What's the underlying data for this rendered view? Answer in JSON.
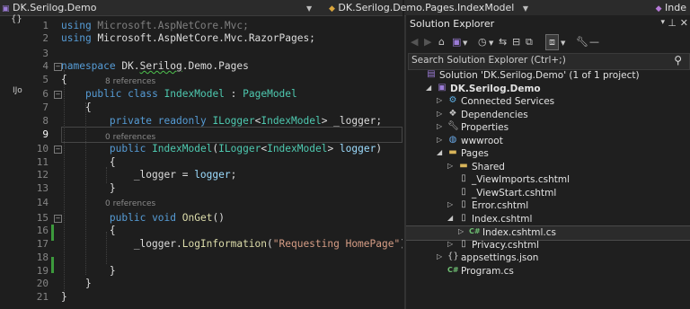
{
  "navbar": {
    "project": "DK.Serilog.Demo",
    "class_path": "DK.Serilog.Demo.Pages.IndexModel",
    "member": "Inde"
  },
  "editor": {
    "refs_line6": "8 references",
    "refs_line10": "0 references",
    "refs_line15": "0 references",
    "lines": [
      {
        "n": "1",
        "parts": [
          [
            "kw",
            "using"
          ],
          [
            "dim",
            " Microsoft.AspNetCore.Mvc;"
          ]
        ]
      },
      {
        "n": "2",
        "parts": [
          [
            "kw",
            "using"
          ],
          [
            "",
            ""
          ],
          [
            "",
            "Microsoft.AspNetCore.Mvc.RazorPages;"
          ]
        ]
      },
      {
        "n": "3",
        "parts": []
      },
      {
        "n": "4",
        "parts": [
          [
            "kw",
            "namespace"
          ],
          [
            "",
            " DK."
          ],
          [
            "squig",
            "Serilog"
          ],
          [
            "",
            ".Demo.Pages"
          ]
        ]
      },
      {
        "n": "5",
        "parts": [
          [
            "",
            "{"
          ]
        ]
      },
      {
        "n": "6",
        "parts": [
          [
            "",
            "    "
          ],
          [
            "kw",
            "public"
          ],
          [
            "",
            " "
          ],
          [
            "kw",
            "class"
          ],
          [
            "",
            " "
          ],
          [
            "ty",
            "IndexModel"
          ],
          [
            "",
            " : "
          ],
          [
            "ty",
            "PageModel"
          ]
        ]
      },
      {
        "n": "7",
        "parts": [
          [
            "",
            "    {"
          ]
        ]
      },
      {
        "n": "8",
        "parts": [
          [
            "",
            "        "
          ],
          [
            "kw",
            "private"
          ],
          [
            "",
            " "
          ],
          [
            "kw",
            "readonly"
          ],
          [
            "",
            " "
          ],
          [
            "ty",
            "ILogger"
          ],
          [
            "",
            "<"
          ],
          [
            "ty",
            "IndexModel"
          ],
          [
            "",
            "> _logger;"
          ]
        ]
      },
      {
        "n": "9",
        "parts": []
      },
      {
        "n": "10",
        "parts": [
          [
            "",
            "        "
          ],
          [
            "kw",
            "public"
          ],
          [
            "",
            " "
          ],
          [
            "ty",
            "IndexModel"
          ],
          [
            "",
            "("
          ],
          [
            "ty",
            "ILogger"
          ],
          [
            "",
            "<"
          ],
          [
            "ty",
            "IndexModel"
          ],
          [
            "",
            "> "
          ],
          [
            "pa",
            "logger"
          ],
          [
            "",
            ")"
          ]
        ]
      },
      {
        "n": "11",
        "parts": [
          [
            "",
            "        {"
          ]
        ]
      },
      {
        "n": "12",
        "parts": [
          [
            "",
            "            _logger = "
          ],
          [
            "pa",
            "logger"
          ],
          [
            "",
            ";"
          ]
        ]
      },
      {
        "n": "13",
        "parts": [
          [
            "",
            "        }"
          ]
        ]
      },
      {
        "n": "14",
        "parts": []
      },
      {
        "n": "15",
        "parts": [
          [
            "",
            "        "
          ],
          [
            "kw",
            "public"
          ],
          [
            "",
            " "
          ],
          [
            "kw",
            "void"
          ],
          [
            "",
            " "
          ],
          [
            "fn",
            "OnGet"
          ],
          [
            "",
            "()"
          ]
        ]
      },
      {
        "n": "16",
        "parts": [
          [
            "",
            "        {"
          ]
        ]
      },
      {
        "n": "17",
        "parts": [
          [
            "",
            "            _logger."
          ],
          [
            "fn",
            "LogInformation"
          ],
          [
            "",
            "("
          ],
          [
            "st",
            "\"Requesting HomePage\""
          ],
          [
            "",
            ");"
          ]
        ]
      },
      {
        "n": "18",
        "parts": []
      },
      {
        "n": "19",
        "parts": [
          [
            "",
            "        }"
          ]
        ]
      },
      {
        "n": "20",
        "parts": [
          [
            "",
            "    }"
          ]
        ]
      },
      {
        "n": "21",
        "parts": [
          [
            "",
            "}"
          ]
        ]
      }
    ]
  },
  "solution_explorer": {
    "title": "Solution Explorer",
    "search_placeholder": "Search Solution Explorer (Ctrl+;)",
    "nodes": [
      {
        "label": "Solution 'DK.Serilog.Demo' (1 of 1 project)",
        "icon": "solution-icon",
        "depth": 0,
        "arrow": ""
      },
      {
        "label": "DK.Serilog.Demo",
        "icon": "project-icon",
        "depth": 1,
        "arrow": "down",
        "bold": true
      },
      {
        "label": "Connected Services",
        "icon": "connected-services-icon",
        "depth": 2,
        "arrow": "right"
      },
      {
        "label": "Dependencies",
        "icon": "dependencies-icon",
        "depth": 2,
        "arrow": "right"
      },
      {
        "label": "Properties",
        "icon": "wrench-icon",
        "depth": 2,
        "arrow": "right"
      },
      {
        "label": "wwwroot",
        "icon": "globe-icon",
        "depth": 2,
        "arrow": "right"
      },
      {
        "label": "Pages",
        "icon": "folder-icon",
        "depth": 2,
        "arrow": "down"
      },
      {
        "label": "Shared",
        "icon": "folder-icon",
        "depth": 3,
        "arrow": "right"
      },
      {
        "label": "_ViewImports.cshtml",
        "icon": "file-icon",
        "depth": 3,
        "arrow": ""
      },
      {
        "label": "_ViewStart.cshtml",
        "icon": "file-icon",
        "depth": 3,
        "arrow": ""
      },
      {
        "label": "Error.cshtml",
        "icon": "file-icon",
        "depth": 3,
        "arrow": "right"
      },
      {
        "label": "Index.cshtml",
        "icon": "file-icon",
        "depth": 3,
        "arrow": "down"
      },
      {
        "label": "Index.cshtml.cs",
        "icon": "csharp-icon",
        "depth": 4,
        "arrow": "right",
        "selected": true
      },
      {
        "label": "Privacy.cshtml",
        "icon": "file-icon",
        "depth": 3,
        "arrow": "right"
      },
      {
        "label": "appsettings.json",
        "icon": "json-icon",
        "depth": 2,
        "arrow": "right"
      },
      {
        "label": "Program.cs",
        "icon": "csharp-icon",
        "depth": 2,
        "arrow": ""
      }
    ]
  },
  "icons": {
    "csharp_glyph": "C#",
    "project_glyph": "▣"
  }
}
